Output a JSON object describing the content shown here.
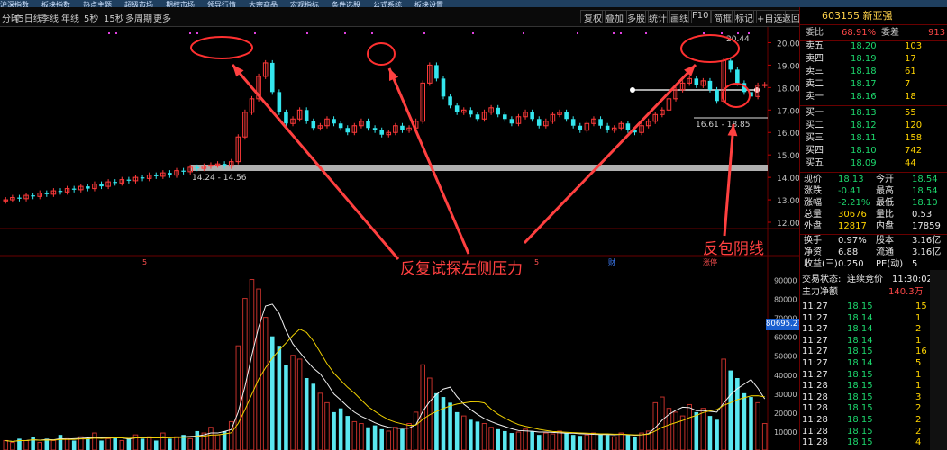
{
  "menu": [
    "沪深指数",
    "板块指数",
    "热点主题",
    "超级市场",
    "期权市场",
    "领导行情",
    "大宗商品",
    "宏观指标",
    "条件选股",
    "公式系统",
    "板块设置"
  ],
  "tabs": [
    "分时",
    "45日线",
    "季线",
    "年线",
    "5秒",
    "15秒",
    "多周期",
    "更多"
  ],
  "right_buttons": [
    "复权",
    "叠加",
    "多股",
    "统计",
    "画线",
    "F10",
    "简框",
    "标记",
    "+自选",
    "返回"
  ],
  "stock": {
    "code": "603155",
    "name": "新亚强"
  },
  "weibi": {
    "label1": "委比",
    "value1": "68.91%",
    "label2": "委差",
    "value2": "913"
  },
  "ask": [
    {
      "label": "卖五",
      "price": "18.20",
      "vol": "103"
    },
    {
      "label": "卖四",
      "price": "18.19",
      "vol": "17"
    },
    {
      "label": "卖三",
      "price": "18.18",
      "vol": "61"
    },
    {
      "label": "卖二",
      "price": "18.17",
      "vol": "7"
    },
    {
      "label": "卖一",
      "price": "18.16",
      "vol": "18"
    }
  ],
  "bid": [
    {
      "label": "买一",
      "price": "18.13",
      "vol": "55"
    },
    {
      "label": "买二",
      "price": "18.12",
      "vol": "120"
    },
    {
      "label": "买三",
      "price": "18.11",
      "vol": "158"
    },
    {
      "label": "买四",
      "price": "18.10",
      "vol": "742"
    },
    {
      "label": "买五",
      "price": "18.09",
      "vol": "44"
    }
  ],
  "quote": [
    {
      "l1": "现价",
      "v1": "18.13",
      "l2": "今开",
      "v2": "18.54"
    },
    {
      "l1": "涨跌",
      "v1": "-0.41",
      "l2": "最高",
      "v2": "18.54"
    },
    {
      "l1": "涨幅",
      "v1": "-2.21%",
      "l2": "最低",
      "v2": "18.10"
    },
    {
      "l1": "总量",
      "v1": "30676",
      "l2": "量比",
      "v2": "0.53"
    },
    {
      "l1": "外盘",
      "v1": "12817",
      "l2": "内盘",
      "v2": "17859"
    },
    {
      "l1": "换手",
      "v1": "0.97%",
      "l2": "股本",
      "v2": "3.16亿"
    },
    {
      "l1": "净资",
      "v1": "6.88",
      "l2": "流通",
      "v2": "3.16亿"
    },
    {
      "l1": "收益(三)",
      "v1": "0.250",
      "l2": "PE(动)",
      "v2": "5"
    }
  ],
  "trade_status": {
    "label": "交易状态:",
    "value": "连续竞价",
    "time": "11:30:02"
  },
  "main_flow": {
    "label": "主力净额",
    "value": "140.3万"
  },
  "trades": [
    {
      "t": "11:27",
      "p": "18.15",
      "v": "15",
      "d": "B"
    },
    {
      "t": "11:27",
      "p": "18.14",
      "v": "1",
      "d": "S"
    },
    {
      "t": "11:27",
      "p": "18.14",
      "v": "2",
      "d": "S"
    },
    {
      "t": "11:27",
      "p": "18.14",
      "v": "1",
      "d": "S"
    },
    {
      "t": "11:27",
      "p": "18.15",
      "v": "16",
      "d": "B"
    },
    {
      "t": "11:27",
      "p": "18.14",
      "v": "5",
      "d": "S"
    },
    {
      "t": "11:27",
      "p": "18.15",
      "v": "1",
      "d": "B"
    },
    {
      "t": "11:28",
      "p": "18.15",
      "v": "1",
      "d": "B"
    },
    {
      "t": "11:28",
      "p": "18.15",
      "v": "3",
      "d": "S"
    },
    {
      "t": "11:28",
      "p": "18.15",
      "v": "2",
      "d": "S"
    },
    {
      "t": "11:28",
      "p": "18.15",
      "v": "2",
      "d": "B"
    },
    {
      "t": "11:28",
      "p": "18.15",
      "v": "2",
      "d": "B"
    },
    {
      "t": "11:28",
      "p": "18.15",
      "v": "4",
      "d": "B"
    },
    {
      "t": "11:28",
      "p": "18.15",
      "v": "1",
      "d": "B"
    }
  ],
  "annotations": {
    "pressure": "反复试探左侧压力",
    "engulf": "反包阴线",
    "high_label": "20.44",
    "band_low": "14.24 - 14.56",
    "band_right": "16.61 - 18.85",
    "price_box": "80695.27"
  },
  "chart_data": {
    "type": "candlestick",
    "price_axis": [
      "20.00",
      "19.00",
      "18.00",
      "17.00",
      "16.00",
      "15.00",
      "14.00",
      "13.00",
      "12.00"
    ],
    "volume_axis": [
      "90000",
      "80000",
      "70000",
      "60000",
      "50000",
      "40000",
      "30000",
      "20000",
      "10000"
    ],
    "closes": [
      13.0,
      13.1,
      13.05,
      13.2,
      13.15,
      13.3,
      13.25,
      13.4,
      13.35,
      13.5,
      13.45,
      13.6,
      13.5,
      13.7,
      13.6,
      13.8,
      13.75,
      13.9,
      13.85,
      14.0,
      13.95,
      14.1,
      14.05,
      14.2,
      14.1,
      14.3,
      14.25,
      14.45,
      14.4,
      14.5,
      14.55,
      14.6,
      14.5,
      14.7,
      15.8,
      16.9,
      17.5,
      18.5,
      19.1,
      17.8,
      16.9,
      16.4,
      16.6,
      17.0,
      16.5,
      16.2,
      16.3,
      16.6,
      16.4,
      16.2,
      16.0,
      16.3,
      16.5,
      16.2,
      16.1,
      15.9,
      16.0,
      16.3,
      16.1,
      16.2,
      16.5,
      18.2,
      19.0,
      18.4,
      17.6,
      17.2,
      16.9,
      17.0,
      16.8,
      16.6,
      16.9,
      17.1,
      16.8,
      16.6,
      16.4,
      16.7,
      16.9,
      16.6,
      16.3,
      16.5,
      16.8,
      16.9,
      16.6,
      16.3,
      16.1,
      16.4,
      16.6,
      16.3,
      16.1,
      16.2,
      16.4,
      16.1,
      16.0,
      16.3,
      16.5,
      16.8,
      17.0,
      17.5,
      17.9,
      18.2,
      18.4,
      18.1,
      18.3,
      17.9,
      17.4,
      19.2,
      18.8,
      18.2,
      17.8,
      17.6,
      18.1,
      18.13
    ],
    "volumes": [
      5000,
      4000,
      6000,
      5000,
      7000,
      4000,
      6000,
      5000,
      8000,
      6000,
      5000,
      7000,
      6000,
      9000,
      5000,
      6000,
      7000,
      5000,
      6000,
      8000,
      6000,
      7000,
      5000,
      9000,
      6000,
      7000,
      8000,
      6000,
      10000,
      9000,
      12000,
      8000,
      10000,
      15000,
      55000,
      80000,
      90000,
      85000,
      70000,
      60000,
      55000,
      45000,
      50000,
      48000,
      38000,
      35000,
      30000,
      25000,
      20000,
      22000,
      18000,
      15000,
      14000,
      12000,
      13000,
      11000,
      10000,
      12000,
      11000,
      14000,
      20000,
      45000,
      38000,
      30000,
      28000,
      25000,
      20000,
      18000,
      16000,
      15000,
      14000,
      12000,
      11000,
      10000,
      9000,
      9500,
      11000,
      10000,
      8000,
      9000,
      8500,
      10000,
      9000,
      8000,
      7500,
      8000,
      9000,
      8500,
      8000,
      7000,
      9000,
      8000,
      7000,
      9000,
      10000,
      25000,
      28000,
      22000,
      20000,
      18000,
      24000,
      20000,
      22000,
      18000,
      16000,
      48000,
      42000,
      38000,
      30000,
      28000,
      25000,
      14000
    ]
  }
}
